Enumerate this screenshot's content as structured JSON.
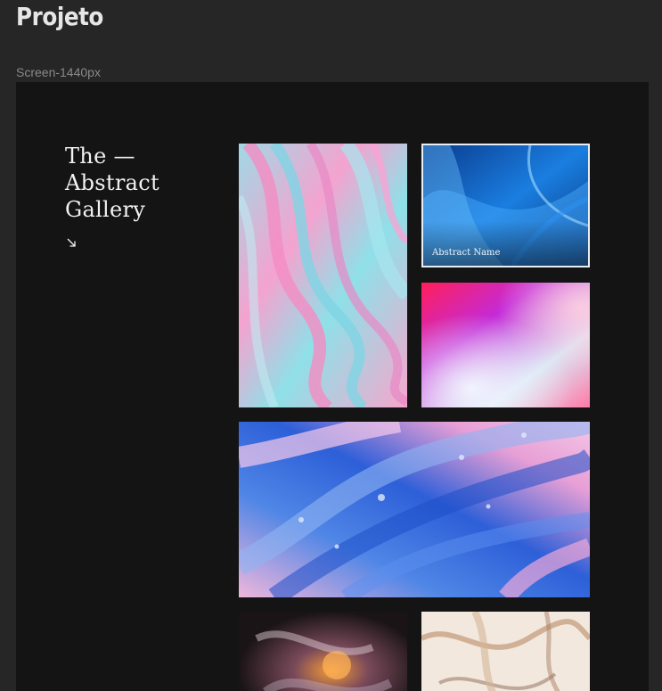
{
  "project": {
    "title": "Projeto"
  },
  "frame": {
    "label": "Screen-1440px"
  },
  "gallery": {
    "heading_lines": [
      "The —",
      "Abstract",
      "Gallery"
    ],
    "arrow_icon": "arrow-down-right-icon",
    "tiles": [
      {
        "name": "pink-teal-marble",
        "caption": ""
      },
      {
        "name": "blue-waves",
        "caption": "Abstract Name"
      },
      {
        "name": "magenta-gradient",
        "caption": ""
      },
      {
        "name": "blue-pink-fluid",
        "caption": ""
      },
      {
        "name": "orange-smoke",
        "caption": ""
      },
      {
        "name": "cream-marble",
        "caption": ""
      }
    ]
  },
  "colors": {
    "app_background": "#262626",
    "frame_background": "#141414",
    "text_primary": "#f2f2f2",
    "text_muted": "#8a8a8a"
  }
}
